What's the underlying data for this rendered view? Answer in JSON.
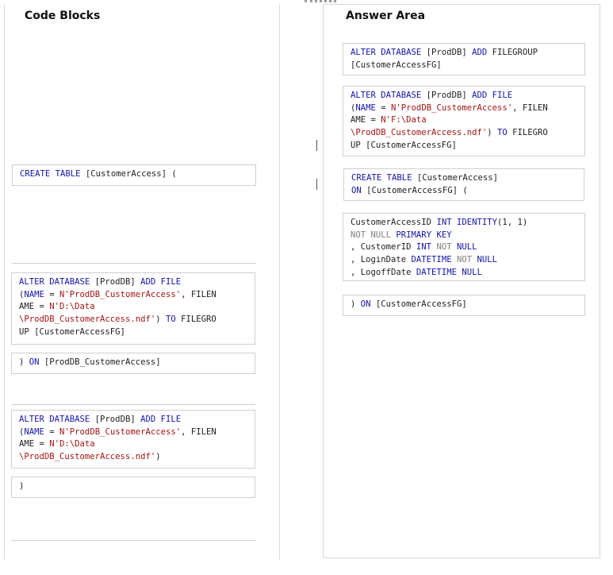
{
  "code_blocks": {
    "title": "Code Blocks",
    "items": [
      {
        "name": "code-block-create-table",
        "lines": [
          [
            [
              "kw",
              "CREATE TABLE"
            ],
            [
              "plain",
              " [CustomerAccess] ("
            ]
          ]
        ]
      },
      {
        "name": "code-block-add-file-d-to-filegroup",
        "lines": [
          [
            [
              "kw",
              "ALTER DATABASE"
            ],
            [
              "plain",
              " [ProdDB] "
            ],
            [
              "kw",
              "ADD FILE"
            ]
          ],
          [
            [
              "plain",
              "("
            ],
            [
              "kw",
              "NAME"
            ],
            [
              "plain",
              " = "
            ],
            [
              "str",
              "N'ProdDB_CustomerAccess'"
            ],
            [
              "plain",
              ", FILEN"
            ]
          ],
          [
            [
              "plain",
              "AME = "
            ],
            [
              "str",
              "N'D:\\Data"
            ]
          ],
          [
            [
              "str",
              "\\ProdDB_CustomerAccess.ndf'"
            ],
            [
              "plain",
              ") "
            ],
            [
              "kw",
              "TO"
            ],
            [
              "plain",
              " FILEGRO"
            ]
          ],
          [
            [
              "plain",
              "UP [CustomerAccessFG]"
            ]
          ]
        ]
      },
      {
        "name": "code-block-on-proddb-customeraccess",
        "lines": [
          [
            [
              "plain",
              ") "
            ],
            [
              "kw",
              "ON"
            ],
            [
              "plain",
              " [ProdDB_CustomerAccess]"
            ]
          ]
        ]
      },
      {
        "name": "code-block-add-file-d",
        "lines": [
          [
            [
              "kw",
              "ALTER DATABASE"
            ],
            [
              "plain",
              " [ProdDB] "
            ],
            [
              "kw",
              "ADD FILE"
            ]
          ],
          [
            [
              "plain",
              "("
            ],
            [
              "kw",
              "NAME"
            ],
            [
              "plain",
              " = "
            ],
            [
              "str",
              "N'ProdDB_CustomerAccess'"
            ],
            [
              "plain",
              ", FILEN"
            ]
          ],
          [
            [
              "plain",
              "AME = "
            ],
            [
              "str",
              "N'D:\\Data"
            ]
          ],
          [
            [
              "str",
              "\\ProdDB_CustomerAccess.ndf'"
            ],
            [
              "plain",
              ")"
            ]
          ]
        ]
      },
      {
        "name": "code-block-close-paren",
        "lines": [
          [
            [
              "plain",
              ")"
            ]
          ]
        ]
      }
    ]
  },
  "answer_area": {
    "title": "Answer Area",
    "items": [
      {
        "name": "answer-block-add-filegroup",
        "lines": [
          [
            [
              "kw",
              "ALTER DATABASE"
            ],
            [
              "plain",
              " [ProdDB] "
            ],
            [
              "kw",
              "ADD"
            ],
            [
              "plain",
              " FILEGROUP"
            ]
          ],
          [
            [
              "plain",
              "[CustomerAccessFG]"
            ]
          ]
        ]
      },
      {
        "name": "answer-block-add-file-f",
        "lines": [
          [
            [
              "kw",
              "ALTER DATABASE"
            ],
            [
              "plain",
              " [ProdDB] "
            ],
            [
              "kw",
              "ADD FILE"
            ]
          ],
          [
            [
              "plain",
              "("
            ],
            [
              "kw",
              "NAME"
            ],
            [
              "plain",
              " = "
            ],
            [
              "str",
              "N'ProdDB_CustomerAccess'"
            ],
            [
              "plain",
              ", FILEN"
            ]
          ],
          [
            [
              "plain",
              "AME = "
            ],
            [
              "str",
              "N'F:\\Data"
            ]
          ],
          [
            [
              "str",
              "\\ProdDB_CustomerAccess.ndf'"
            ],
            [
              "plain",
              ") "
            ],
            [
              "kw",
              "TO"
            ],
            [
              "plain",
              " FILEGRO"
            ]
          ],
          [
            [
              "plain",
              "UP [CustomerAccessFG]"
            ]
          ]
        ]
      },
      {
        "name": "answer-block-create-table-on-fg",
        "lines": [
          [
            [
              "kw",
              "CREATE TABLE"
            ],
            [
              "plain",
              " [CustomerAccess]"
            ]
          ],
          [
            [
              "kw",
              "ON"
            ],
            [
              "plain",
              " [CustomerAccessFG] ("
            ]
          ]
        ]
      },
      {
        "name": "answer-block-columns",
        "lines": [
          [
            [
              "plain",
              "CustomerAccessID "
            ],
            [
              "kw",
              "INT IDENTITY"
            ],
            [
              "plain",
              "(1, 1)"
            ]
          ],
          [
            [
              "gr",
              "NOT NULL"
            ],
            [
              "plain",
              " "
            ],
            [
              "kw",
              "PRIMARY KEY"
            ]
          ],
          [
            [
              "plain",
              ", CustomerID "
            ],
            [
              "kw",
              "INT"
            ],
            [
              "plain",
              " "
            ],
            [
              "gr",
              "NOT"
            ],
            [
              "plain",
              " "
            ],
            [
              "kw",
              "NULL"
            ]
          ],
          [
            [
              "plain",
              ", LoginDate "
            ],
            [
              "kw",
              "DATETIME"
            ],
            [
              "plain",
              " "
            ],
            [
              "gr",
              "NOT"
            ],
            [
              "plain",
              " "
            ],
            [
              "kw",
              "NULL"
            ]
          ],
          [
            [
              "plain",
              ", LogoffDate "
            ],
            [
              "kw",
              "DATETIME NULL"
            ]
          ]
        ]
      },
      {
        "name": "answer-block-on-customeraccessfg",
        "lines": [
          [
            [
              "plain",
              ") "
            ],
            [
              "kw",
              "ON"
            ],
            [
              "plain",
              " [CustomerAccessFG]"
            ]
          ]
        ]
      }
    ]
  }
}
